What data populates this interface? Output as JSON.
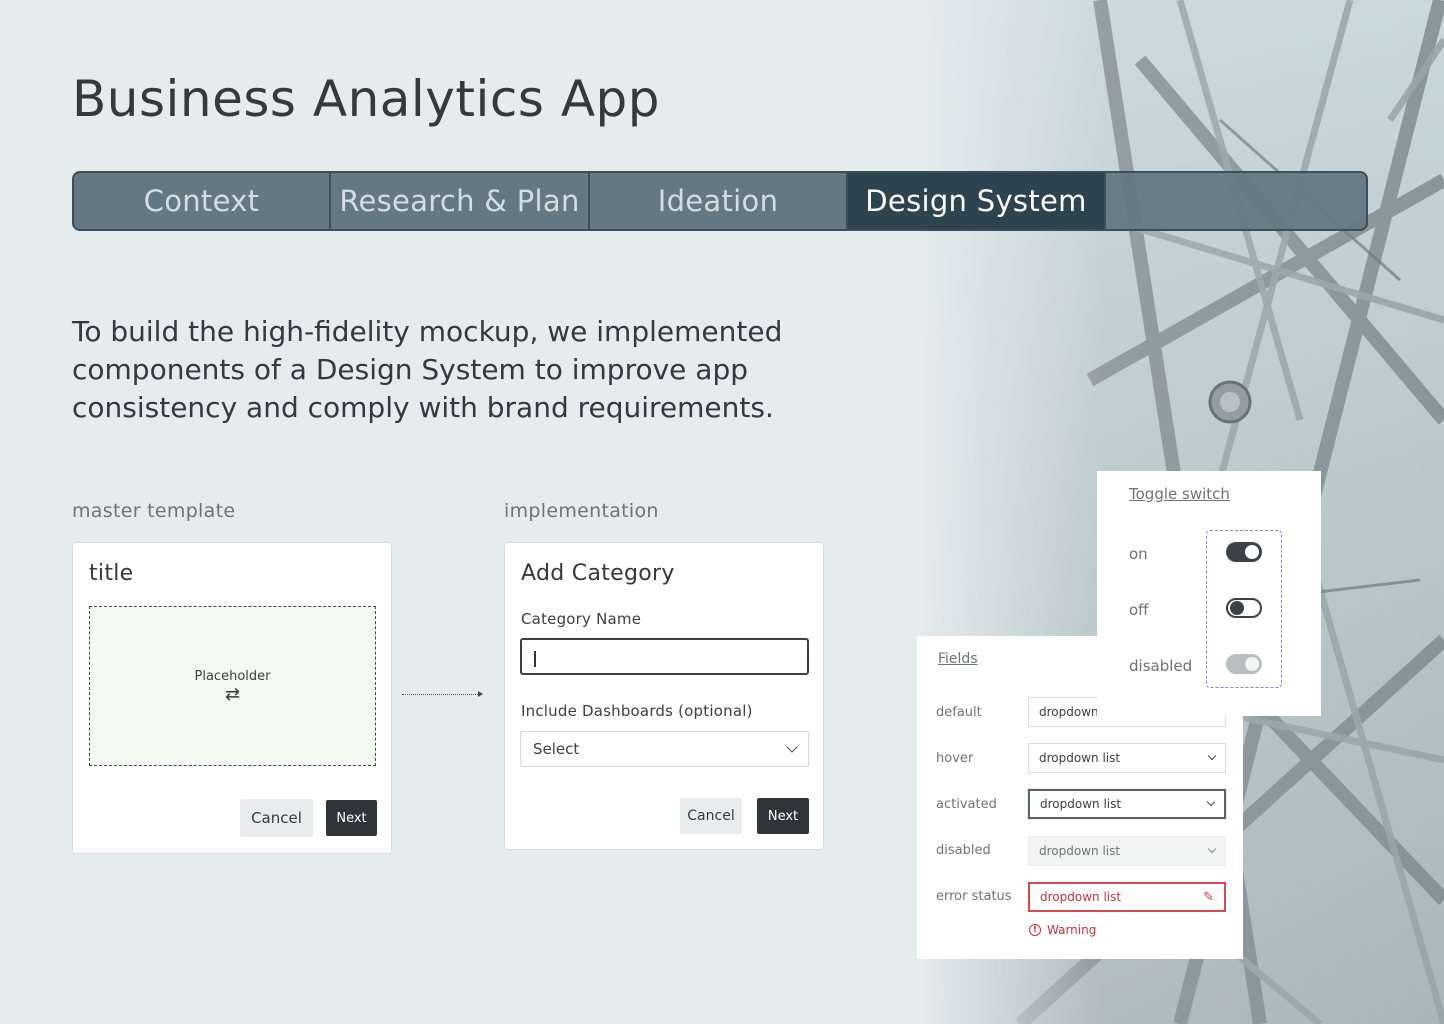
{
  "page": {
    "title": "Business Analytics App",
    "intro": "To build the high-fidelity mockup, we implemented components of a Design System to improve app consistency and comply with brand requirements."
  },
  "tabs": [
    {
      "label": "Context",
      "active": false
    },
    {
      "label": "Research & Plan",
      "active": false
    },
    {
      "label": "Ideation",
      "active": false
    },
    {
      "label": "Design System",
      "active": true
    }
  ],
  "master": {
    "section_label": "master template",
    "title": "title",
    "placeholder": "Placeholder",
    "placeholder_icon": "swap-icon",
    "cancel": "Cancel",
    "next": "Next"
  },
  "implementation": {
    "section_label": "implementation",
    "title": "Add Category",
    "category_label": "Category Name",
    "category_value": "",
    "dashboards_label": "Include Dashboards (optional)",
    "dashboards_value": "Select",
    "cancel": "Cancel",
    "next": "Next"
  },
  "fields_panel": {
    "heading": "Fields",
    "states": [
      {
        "label": "default",
        "value": "dropdown list"
      },
      {
        "label": "hover",
        "value": "dropdown list"
      },
      {
        "label": "activated",
        "value": "dropdown list"
      },
      {
        "label": "disabled",
        "value": "dropdown list"
      },
      {
        "label": "error status",
        "value": "dropdown list"
      }
    ],
    "warning": "Warning",
    "error_color": "#d8484f"
  },
  "toggle_panel": {
    "heading": "Toggle switch",
    "states": [
      {
        "label": "on",
        "state": "on"
      },
      {
        "label": "off",
        "state": "off"
      },
      {
        "label": "disabled",
        "state": "disabled"
      }
    ],
    "outline_color": "#8b7ee6"
  },
  "colors": {
    "background": "#e4eced",
    "tab_active": "#2d4450",
    "tab_inactive": "#586e79",
    "primary_button": "#2f3438"
  }
}
